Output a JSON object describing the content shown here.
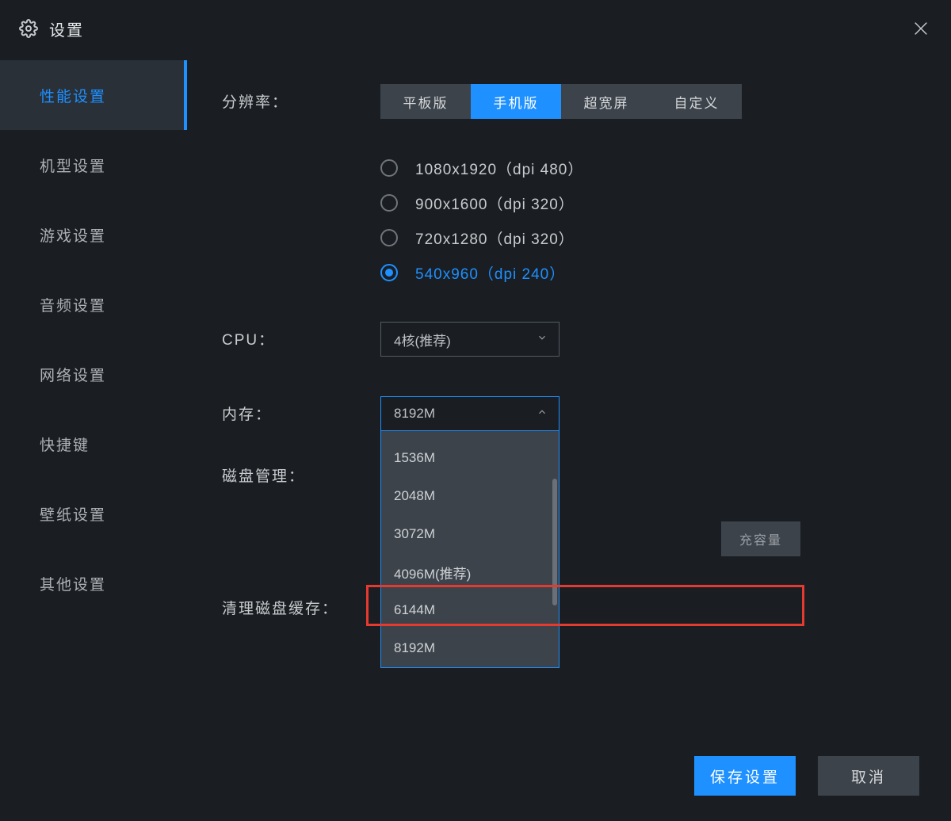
{
  "title": "设置",
  "sidebar": [
    {
      "label": "性能设置",
      "active": true
    },
    {
      "label": "机型设置",
      "active": false
    },
    {
      "label": "游戏设置",
      "active": false
    },
    {
      "label": "音频设置",
      "active": false
    },
    {
      "label": "网络设置",
      "active": false
    },
    {
      "label": "快捷键",
      "active": false
    },
    {
      "label": "壁纸设置",
      "active": false
    },
    {
      "label": "其他设置",
      "active": false
    }
  ],
  "labels": {
    "resolution": "分辨率：",
    "cpu": "CPU：",
    "memory": "内存：",
    "disk": "磁盘管理：",
    "clear_cache": "清理磁盘缓存："
  },
  "tabs": [
    {
      "label": "平板版",
      "active": false
    },
    {
      "label": "手机版",
      "active": true
    },
    {
      "label": "超宽屏",
      "active": false
    },
    {
      "label": "自定义",
      "active": false
    }
  ],
  "radios": [
    {
      "label": "1080x1920（dpi 480）",
      "selected": false
    },
    {
      "label": "900x1600（dpi 320）",
      "selected": false
    },
    {
      "label": "720x1280（dpi 320）",
      "selected": false
    },
    {
      "label": "540x960（dpi 240）",
      "selected": true
    }
  ],
  "cpu_select": {
    "value": "4核(推荐)"
  },
  "memory_select": {
    "value": "8192M",
    "options": [
      "1536M",
      "2048M",
      "3072M",
      "4096M(推荐)",
      "6144M",
      "8192M"
    ]
  },
  "ghost_button": "充容量",
  "footer": {
    "save": "保存设置",
    "cancel": "取消"
  }
}
